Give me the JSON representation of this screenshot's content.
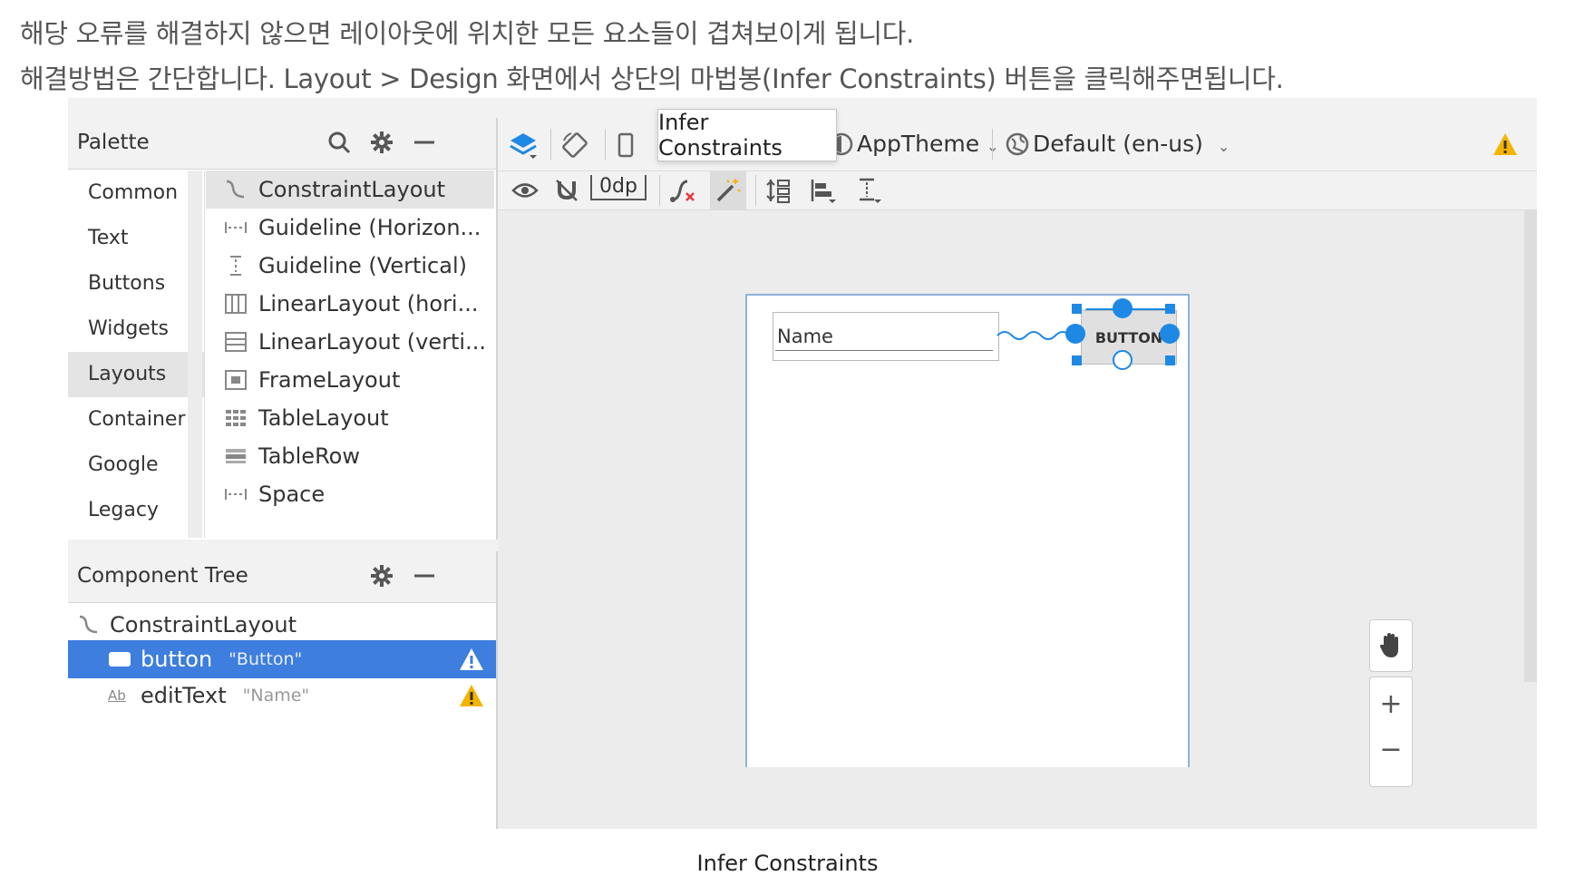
{
  "article": {
    "line1": "해당 오류를 해결하지 않으면 레이아웃에 위치한 모든 요소들이 겹쳐보이게 됩니다.",
    "line2": "해결방법은 간단합니다. Layout > Design 화면에서 상단의 마법봉(Infer Constraints) 버튼을 클릭해주면됩니다.",
    "caption": "Infer Constraints"
  },
  "palette": {
    "title": "Palette",
    "categories": [
      "Common",
      "Text",
      "Buttons",
      "Widgets",
      "Layouts",
      "Container",
      "Google",
      "Legacy"
    ],
    "selected_category": "Layouts",
    "items": [
      {
        "label": "ConstraintLayout",
        "icon": "constraint-layout-icon"
      },
      {
        "label": "Guideline (Horizon...",
        "icon": "guideline-horizontal-icon"
      },
      {
        "label": "Guideline (Vertical)",
        "icon": "guideline-vertical-icon"
      },
      {
        "label": "LinearLayout (hori...",
        "icon": "linear-horizontal-icon"
      },
      {
        "label": "LinearLayout (verti...",
        "icon": "linear-vertical-icon"
      },
      {
        "label": "FrameLayout",
        "icon": "frame-layout-icon"
      },
      {
        "label": "TableLayout",
        "icon": "table-layout-icon"
      },
      {
        "label": "TableRow",
        "icon": "table-row-icon"
      },
      {
        "label": "Space",
        "icon": "space-icon"
      }
    ]
  },
  "tree": {
    "title": "Component Tree",
    "rows": [
      {
        "label": "ConstraintLayout",
        "sub": ""
      },
      {
        "label": "button",
        "sub": "\"Button\""
      },
      {
        "label": "editText",
        "sub": "\"Name\""
      }
    ]
  },
  "toolbar": {
    "tooltip": "Infer Constraints",
    "theme": "AppTheme",
    "locale": "Default (en-us)",
    "margin": "0dp"
  },
  "canvas": {
    "edit_text": "Name",
    "button_text": "BUTTON"
  },
  "colors": {
    "selection": "#3d7ede",
    "constraint": "#1e88e5",
    "warning": "#f4b400"
  }
}
